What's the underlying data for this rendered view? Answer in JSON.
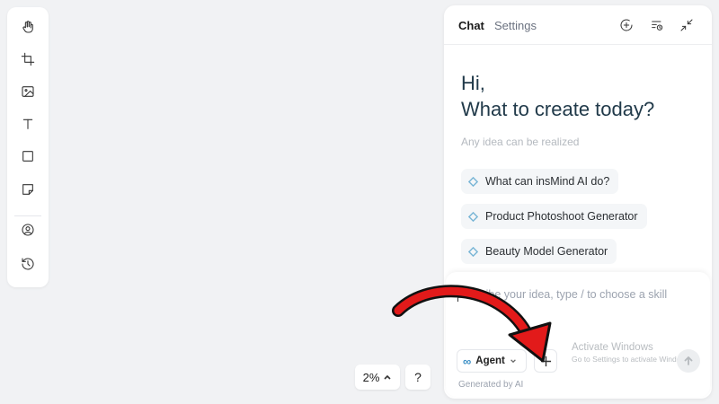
{
  "toolbar": {
    "tools": [
      {
        "name": "hand-icon"
      },
      {
        "name": "crop-icon"
      },
      {
        "name": "image-icon"
      },
      {
        "name": "text-icon"
      },
      {
        "name": "rectangle-icon"
      },
      {
        "name": "sticky-note-icon"
      },
      {
        "name": "avatar-icon"
      },
      {
        "name": "history-icon"
      }
    ]
  },
  "zoom": {
    "value": "2%",
    "help_label": "?"
  },
  "chat": {
    "tab_chat": "Chat",
    "tab_settings": "Settings",
    "greeting_line1": "Hi,",
    "greeting_line2": "What to create today?",
    "subline": "Any idea can be realized",
    "suggestions": [
      {
        "label": "What can insMind AI do?"
      },
      {
        "label": "Product Photoshoot Generator"
      },
      {
        "label": "Beauty Model Generator"
      }
    ],
    "input_placeholder": "Describe your idea, type / to choose a skill",
    "agent_label": "Agent",
    "agent_icon": "∞",
    "generated_note": "Generated by AI"
  },
  "watermark": {
    "line1": "Activate Windows",
    "line2": "Go to Settings to activate Windows."
  },
  "colors": {
    "background": "#f1f2f4",
    "greeting_text": "#213a4a",
    "arrow_red": "#e21a1a",
    "accent_blue": "#3a8ec5"
  }
}
